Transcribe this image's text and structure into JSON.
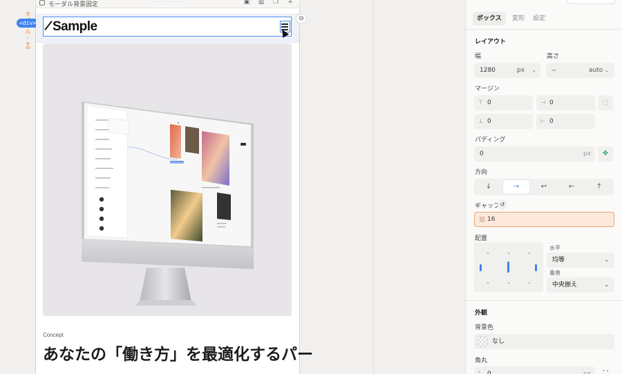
{
  "canvas": {
    "frame_top_label": "モーダル背景固定",
    "side_label": "モバイル – xd",
    "element_badge": "<div>",
    "brand": "Sample",
    "concept_label": "Concept",
    "headline": "あなたの「働き方」を最適化するパー"
  },
  "panel": {
    "tabs": [
      {
        "label": "ボックス",
        "active": true
      },
      {
        "label": "変形",
        "active": false
      },
      {
        "label": "設定",
        "active": false
      }
    ],
    "layout": {
      "title": "レイアウト",
      "width_label": "幅",
      "width_value": "1280",
      "width_unit": "px",
      "height_label": "高さ",
      "height_value": "--",
      "height_unit": "auto",
      "margin_label": "マージン",
      "margin_top": "0",
      "margin_right": "0",
      "margin_bottom": "0",
      "margin_left": "0",
      "padding_label": "パディング",
      "padding_value": "0",
      "padding_unit": "px",
      "direction_label": "方向",
      "direction_options": [
        "↓",
        "→",
        "↩",
        "←",
        "↑"
      ],
      "gap_label": "ギャップ",
      "gap_value": "16",
      "align_label": "配置",
      "horizontal_label": "水平",
      "horizontal_value": "均等",
      "vertical_label": "垂直",
      "vertical_value": "中央揃え"
    },
    "appearance": {
      "title": "外観",
      "bg_label": "背景色",
      "bg_value": "なし",
      "radius_label": "角丸",
      "radius_value": "0",
      "radius_unit": "px"
    }
  },
  "colors": {
    "accent": "#3f83f0",
    "highlight": "#fde9dc",
    "frame_border": "#f0c8a8"
  }
}
